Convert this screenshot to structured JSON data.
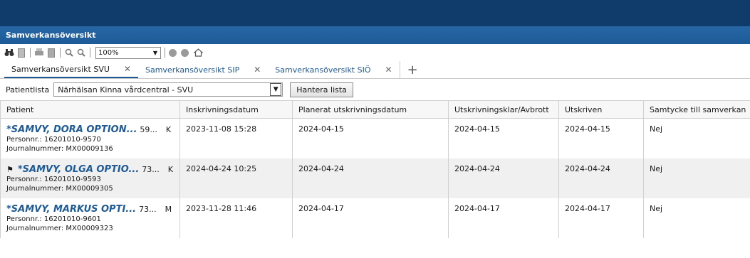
{
  "window": {
    "title": "Samverkansöversikt"
  },
  "toolbar": {
    "icons": [
      "binoculars-icon",
      "page-icon",
      "print-icon",
      "print-page-icon",
      "zoom-in-icon",
      "zoom-out-icon",
      "dot-icon",
      "dot-icon",
      "home-icon"
    ],
    "zoom": "100%"
  },
  "tabs": [
    {
      "label": "Samverkansöversikt SVU",
      "active": true
    },
    {
      "label": "Samverkansöversikt SIP",
      "active": false
    },
    {
      "label": "Samverkansöversikt SIÖ",
      "active": false
    }
  ],
  "filter": {
    "label": "Patientlista",
    "value": "Närhälsan Kinna vårdcentral - SVU",
    "button": "Hantera lista"
  },
  "table": {
    "headers": [
      "Patient",
      "Inskrivningsdatum",
      "Planerat utskrivningsdatum",
      "Utskrivningsklar/Avbrott",
      "Utskriven",
      "Samtycke till samverkan"
    ],
    "rows": [
      {
        "flag": "",
        "name": "*SAMVY, DORA OPTION...",
        "age": "59...",
        "sex": "K",
        "personnr": "Personnr.: 16201010-9570",
        "journal": "Journalnummer: MX00009136",
        "inskrivning": "2023-11-08 15:28",
        "planerat": "2024-04-15",
        "klar": "2024-04-15",
        "utskriven": "2024-04-15",
        "samtycke": "Nej"
      },
      {
        "flag": "⚑",
        "name": "*SAMVY, OLGA OPTIO...",
        "age": "73...",
        "sex": "K",
        "personnr": "Personnr.: 16201010-9593",
        "journal": "Journalnummer: MX00009305",
        "inskrivning": "2024-04-24 10:25",
        "planerat": "2024-04-24",
        "klar": "2024-04-24",
        "utskriven": "2024-04-24",
        "samtycke": "Nej"
      },
      {
        "flag": "",
        "name": "*SAMVY, MARKUS OPTI...",
        "age": "73...",
        "sex": "M",
        "personnr": "Personnr.: 16201010-9601",
        "journal": "Journalnummer: MX00009323",
        "inskrivning": "2023-11-28 11:46",
        "planerat": "2024-04-17",
        "klar": "2024-04-17",
        "utskriven": "2024-04-17",
        "samtycke": "Nej"
      }
    ]
  }
}
